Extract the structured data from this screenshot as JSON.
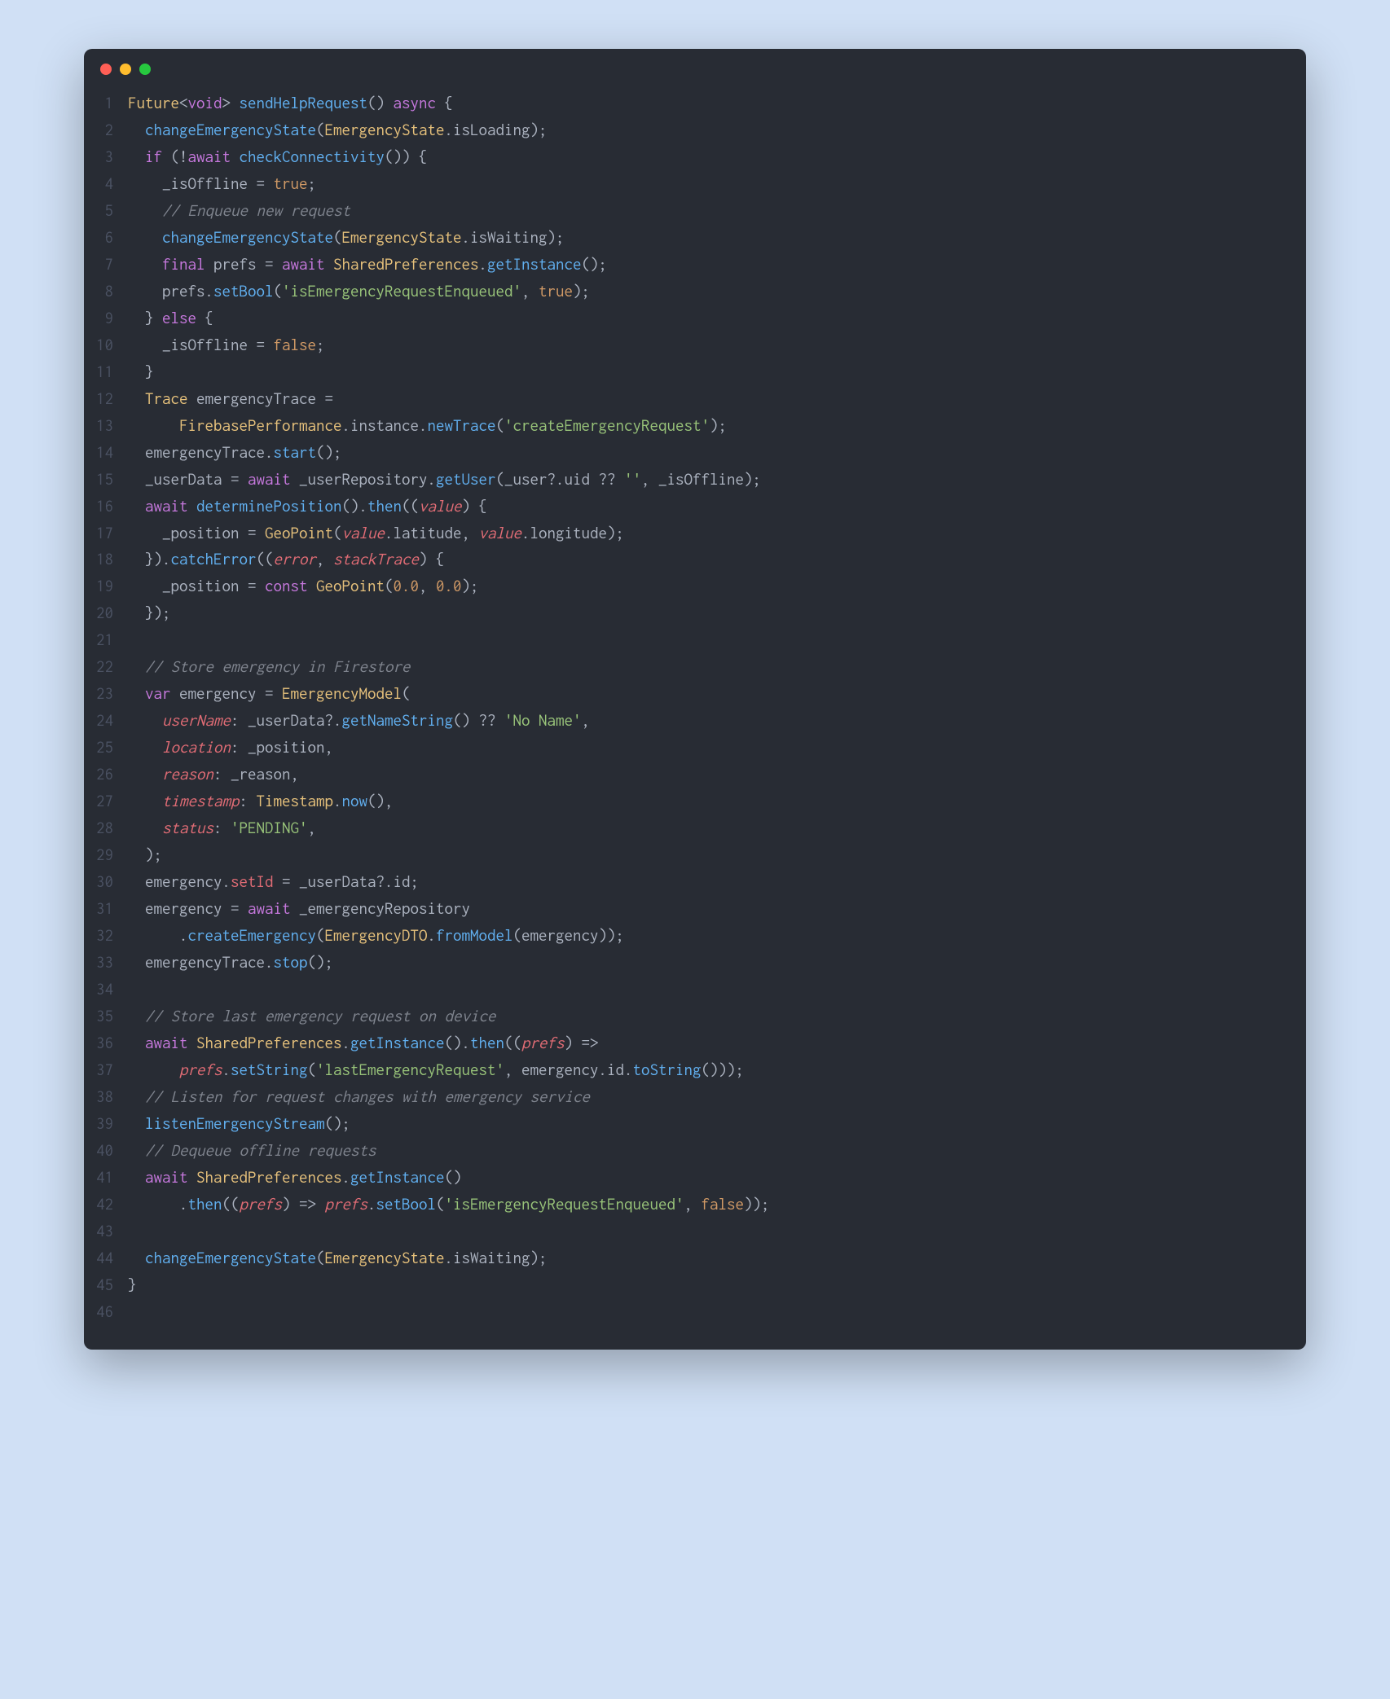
{
  "window": {
    "traffic": {
      "red": "#ff5f56",
      "yellow": "#ffbd2e",
      "green": "#27c93f"
    }
  },
  "code": {
    "lines": [
      {
        "n": 1,
        "t": [
          [
            "type",
            "Future"
          ],
          [
            "punct",
            "<"
          ],
          [
            "kw",
            "void"
          ],
          [
            "punct",
            ">"
          ],
          [
            "ident",
            " "
          ],
          [
            "fn",
            "sendHelpRequest"
          ],
          [
            "punct",
            "() "
          ],
          [
            "kw",
            "async"
          ],
          [
            "punct",
            " {"
          ]
        ]
      },
      {
        "n": 2,
        "t": [
          [
            "ident",
            "  "
          ],
          [
            "fn",
            "changeEmergencyState"
          ],
          [
            "punct",
            "("
          ],
          [
            "type",
            "EmergencyState"
          ],
          [
            "punct",
            "."
          ],
          [
            "ident",
            "isLoading"
          ],
          [
            "punct",
            ");"
          ]
        ]
      },
      {
        "n": 3,
        "t": [
          [
            "ident",
            "  "
          ],
          [
            "kw",
            "if"
          ],
          [
            "punct",
            " (!"
          ],
          [
            "kw",
            "await"
          ],
          [
            "ident",
            " "
          ],
          [
            "fn",
            "checkConnectivity"
          ],
          [
            "punct",
            "()) {"
          ]
        ]
      },
      {
        "n": 4,
        "t": [
          [
            "ident",
            "    _isOffline "
          ],
          [
            "op",
            "="
          ],
          [
            "ident",
            " "
          ],
          [
            "bool",
            "true"
          ],
          [
            "punct",
            ";"
          ]
        ]
      },
      {
        "n": 5,
        "t": [
          [
            "ident",
            "    "
          ],
          [
            "comment",
            "// Enqueue new request"
          ]
        ]
      },
      {
        "n": 6,
        "t": [
          [
            "ident",
            "    "
          ],
          [
            "fn",
            "changeEmergencyState"
          ],
          [
            "punct",
            "("
          ],
          [
            "type",
            "EmergencyState"
          ],
          [
            "punct",
            "."
          ],
          [
            "ident",
            "isWaiting"
          ],
          [
            "punct",
            ");"
          ]
        ]
      },
      {
        "n": 7,
        "t": [
          [
            "ident",
            "    "
          ],
          [
            "kw",
            "final"
          ],
          [
            "ident",
            " prefs "
          ],
          [
            "op",
            "="
          ],
          [
            "ident",
            " "
          ],
          [
            "kw",
            "await"
          ],
          [
            "ident",
            " "
          ],
          [
            "type",
            "SharedPreferences"
          ],
          [
            "punct",
            "."
          ],
          [
            "fn",
            "getInstance"
          ],
          [
            "punct",
            "();"
          ]
        ]
      },
      {
        "n": 8,
        "t": [
          [
            "ident",
            "    prefs."
          ],
          [
            "fn",
            "setBool"
          ],
          [
            "punct",
            "("
          ],
          [
            "str",
            "'isEmergencyRequestEnqueued'"
          ],
          [
            "punct",
            ", "
          ],
          [
            "bool",
            "true"
          ],
          [
            "punct",
            ");"
          ]
        ]
      },
      {
        "n": 9,
        "t": [
          [
            "ident",
            "  } "
          ],
          [
            "kw",
            "else"
          ],
          [
            "punct",
            " {"
          ]
        ]
      },
      {
        "n": 10,
        "t": [
          [
            "ident",
            "    _isOffline "
          ],
          [
            "op",
            "="
          ],
          [
            "ident",
            " "
          ],
          [
            "bool",
            "false"
          ],
          [
            "punct",
            ";"
          ]
        ]
      },
      {
        "n": 11,
        "t": [
          [
            "ident",
            "  }"
          ]
        ]
      },
      {
        "n": 12,
        "t": [
          [
            "ident",
            "  "
          ],
          [
            "type",
            "Trace"
          ],
          [
            "ident",
            " emergencyTrace "
          ],
          [
            "op",
            "="
          ]
        ]
      },
      {
        "n": 13,
        "t": [
          [
            "ident",
            "      "
          ],
          [
            "type",
            "FirebasePerformance"
          ],
          [
            "punct",
            "."
          ],
          [
            "ident",
            "instance"
          ],
          [
            "punct",
            "."
          ],
          [
            "fn",
            "newTrace"
          ],
          [
            "punct",
            "("
          ],
          [
            "str",
            "'createEmergencyRequest'"
          ],
          [
            "punct",
            ");"
          ]
        ]
      },
      {
        "n": 14,
        "t": [
          [
            "ident",
            "  emergencyTrace."
          ],
          [
            "fn",
            "start"
          ],
          [
            "punct",
            "();"
          ]
        ]
      },
      {
        "n": 15,
        "t": [
          [
            "ident",
            "  _userData "
          ],
          [
            "op",
            "="
          ],
          [
            "ident",
            " "
          ],
          [
            "kw",
            "await"
          ],
          [
            "ident",
            " _userRepository."
          ],
          [
            "fn",
            "getUser"
          ],
          [
            "punct",
            "(_user?."
          ],
          [
            "ident",
            "uid"
          ],
          [
            "punct",
            " "
          ],
          [
            "op",
            "??"
          ],
          [
            "punct",
            " "
          ],
          [
            "str",
            "''"
          ],
          [
            "punct",
            ", _isOffline);"
          ]
        ]
      },
      {
        "n": 16,
        "t": [
          [
            "ident",
            "  "
          ],
          [
            "kw",
            "await"
          ],
          [
            "ident",
            " "
          ],
          [
            "fn",
            "determinePosition"
          ],
          [
            "punct",
            "()."
          ],
          [
            "fn",
            "then"
          ],
          [
            "punct",
            "(("
          ],
          [
            "param",
            "value"
          ],
          [
            "punct",
            ") {"
          ]
        ]
      },
      {
        "n": 17,
        "t": [
          [
            "ident",
            "    _position "
          ],
          [
            "op",
            "="
          ],
          [
            "ident",
            " "
          ],
          [
            "type",
            "GeoPoint"
          ],
          [
            "punct",
            "("
          ],
          [
            "param",
            "value"
          ],
          [
            "punct",
            "."
          ],
          [
            "ident",
            "latitude"
          ],
          [
            "punct",
            ", "
          ],
          [
            "param",
            "value"
          ],
          [
            "punct",
            "."
          ],
          [
            "ident",
            "longitude"
          ],
          [
            "punct",
            ");"
          ]
        ]
      },
      {
        "n": 18,
        "t": [
          [
            "ident",
            "  })."
          ],
          [
            "fn",
            "catchError"
          ],
          [
            "punct",
            "(("
          ],
          [
            "param",
            "error"
          ],
          [
            "punct",
            ", "
          ],
          [
            "param",
            "stackTrace"
          ],
          [
            "punct",
            ") {"
          ]
        ]
      },
      {
        "n": 19,
        "t": [
          [
            "ident",
            "    _position "
          ],
          [
            "op",
            "="
          ],
          [
            "ident",
            " "
          ],
          [
            "kw",
            "const"
          ],
          [
            "ident",
            " "
          ],
          [
            "type",
            "GeoPoint"
          ],
          [
            "punct",
            "("
          ],
          [
            "num",
            "0.0"
          ],
          [
            "punct",
            ", "
          ],
          [
            "num",
            "0.0"
          ],
          [
            "punct",
            ");"
          ]
        ]
      },
      {
        "n": 20,
        "t": [
          [
            "ident",
            "  });"
          ]
        ]
      },
      {
        "n": 21,
        "t": [
          [
            "ident",
            ""
          ]
        ]
      },
      {
        "n": 22,
        "t": [
          [
            "ident",
            "  "
          ],
          [
            "comment",
            "// Store emergency in Firestore"
          ]
        ]
      },
      {
        "n": 23,
        "t": [
          [
            "ident",
            "  "
          ],
          [
            "kw",
            "var"
          ],
          [
            "ident",
            " emergency "
          ],
          [
            "op",
            "="
          ],
          [
            "ident",
            " "
          ],
          [
            "type",
            "EmergencyModel"
          ],
          [
            "punct",
            "("
          ]
        ]
      },
      {
        "n": 24,
        "t": [
          [
            "ident",
            "    "
          ],
          [
            "named",
            "userName"
          ],
          [
            "punct",
            ": _userData?."
          ],
          [
            "fn",
            "getNameString"
          ],
          [
            "punct",
            "() "
          ],
          [
            "op",
            "??"
          ],
          [
            "punct",
            " "
          ],
          [
            "str",
            "'No Name'"
          ],
          [
            "punct",
            ","
          ]
        ]
      },
      {
        "n": 25,
        "t": [
          [
            "ident",
            "    "
          ],
          [
            "named",
            "location"
          ],
          [
            "punct",
            ": _position,"
          ]
        ]
      },
      {
        "n": 26,
        "t": [
          [
            "ident",
            "    "
          ],
          [
            "named",
            "reason"
          ],
          [
            "punct",
            ": _reason,"
          ]
        ]
      },
      {
        "n": 27,
        "t": [
          [
            "ident",
            "    "
          ],
          [
            "named",
            "timestamp"
          ],
          [
            "punct",
            ": "
          ],
          [
            "type",
            "Timestamp"
          ],
          [
            "punct",
            "."
          ],
          [
            "fn",
            "now"
          ],
          [
            "punct",
            "(),"
          ]
        ]
      },
      {
        "n": 28,
        "t": [
          [
            "ident",
            "    "
          ],
          [
            "named",
            "status"
          ],
          [
            "punct",
            ": "
          ],
          [
            "str",
            "'PENDING'"
          ],
          [
            "punct",
            ","
          ]
        ]
      },
      {
        "n": 29,
        "t": [
          [
            "ident",
            "  );"
          ]
        ]
      },
      {
        "n": 30,
        "t": [
          [
            "ident",
            "  emergency."
          ],
          [
            "prop",
            "setId"
          ],
          [
            "punct",
            " "
          ],
          [
            "op",
            "="
          ],
          [
            "ident",
            " _userData?."
          ],
          [
            "ident",
            "id"
          ],
          [
            "punct",
            ";"
          ]
        ]
      },
      {
        "n": 31,
        "t": [
          [
            "ident",
            "  emergency "
          ],
          [
            "op",
            "="
          ],
          [
            "ident",
            " "
          ],
          [
            "kw",
            "await"
          ],
          [
            "ident",
            " _emergencyRepository"
          ]
        ]
      },
      {
        "n": 32,
        "t": [
          [
            "ident",
            "      ."
          ],
          [
            "fn",
            "createEmergency"
          ],
          [
            "punct",
            "("
          ],
          [
            "type",
            "EmergencyDTO"
          ],
          [
            "punct",
            "."
          ],
          [
            "fn",
            "fromModel"
          ],
          [
            "punct",
            "(emergency));"
          ]
        ]
      },
      {
        "n": 33,
        "t": [
          [
            "ident",
            "  emergencyTrace."
          ],
          [
            "fn",
            "stop"
          ],
          [
            "punct",
            "();"
          ]
        ]
      },
      {
        "n": 34,
        "t": [
          [
            "ident",
            ""
          ]
        ]
      },
      {
        "n": 35,
        "t": [
          [
            "ident",
            "  "
          ],
          [
            "comment",
            "// Store last emergency request on device"
          ]
        ]
      },
      {
        "n": 36,
        "t": [
          [
            "ident",
            "  "
          ],
          [
            "kw",
            "await"
          ],
          [
            "ident",
            " "
          ],
          [
            "type",
            "SharedPreferences"
          ],
          [
            "punct",
            "."
          ],
          [
            "fn",
            "getInstance"
          ],
          [
            "punct",
            "()."
          ],
          [
            "fn",
            "then"
          ],
          [
            "punct",
            "(("
          ],
          [
            "param",
            "prefs"
          ],
          [
            "punct",
            ") "
          ],
          [
            "op",
            "=>"
          ]
        ]
      },
      {
        "n": 37,
        "t": [
          [
            "ident",
            "      "
          ],
          [
            "param",
            "prefs"
          ],
          [
            "punct",
            "."
          ],
          [
            "fn",
            "setString"
          ],
          [
            "punct",
            "("
          ],
          [
            "str",
            "'lastEmergencyRequest'"
          ],
          [
            "punct",
            ", emergency."
          ],
          [
            "ident",
            "id"
          ],
          [
            "punct",
            "."
          ],
          [
            "fn",
            "toString"
          ],
          [
            "punct",
            "()));"
          ]
        ]
      },
      {
        "n": 38,
        "t": [
          [
            "ident",
            "  "
          ],
          [
            "comment",
            "// Listen for request changes with emergency service"
          ]
        ]
      },
      {
        "n": 39,
        "t": [
          [
            "ident",
            "  "
          ],
          [
            "fn",
            "listenEmergencyStream"
          ],
          [
            "punct",
            "();"
          ]
        ]
      },
      {
        "n": 40,
        "t": [
          [
            "ident",
            "  "
          ],
          [
            "comment",
            "// Dequeue offline requests"
          ]
        ]
      },
      {
        "n": 41,
        "t": [
          [
            "ident",
            "  "
          ],
          [
            "kw",
            "await"
          ],
          [
            "ident",
            " "
          ],
          [
            "type",
            "SharedPreferences"
          ],
          [
            "punct",
            "."
          ],
          [
            "fn",
            "getInstance"
          ],
          [
            "punct",
            "()"
          ]
        ]
      },
      {
        "n": 42,
        "t": [
          [
            "ident",
            "      ."
          ],
          [
            "fn",
            "then"
          ],
          [
            "punct",
            "(("
          ],
          [
            "param",
            "prefs"
          ],
          [
            "punct",
            ") "
          ],
          [
            "op",
            "=>"
          ],
          [
            "punct",
            " "
          ],
          [
            "param",
            "prefs"
          ],
          [
            "punct",
            "."
          ],
          [
            "fn",
            "setBool"
          ],
          [
            "punct",
            "("
          ],
          [
            "str",
            "'isEmergencyRequestEnqueued'"
          ],
          [
            "punct",
            ", "
          ],
          [
            "bool",
            "false"
          ],
          [
            "punct",
            "));"
          ]
        ]
      },
      {
        "n": 43,
        "t": [
          [
            "ident",
            ""
          ]
        ]
      },
      {
        "n": 44,
        "t": [
          [
            "ident",
            "  "
          ],
          [
            "fn",
            "changeEmergencyState"
          ],
          [
            "punct",
            "("
          ],
          [
            "type",
            "EmergencyState"
          ],
          [
            "punct",
            "."
          ],
          [
            "ident",
            "isWaiting"
          ],
          [
            "punct",
            ");"
          ]
        ]
      },
      {
        "n": 45,
        "t": [
          [
            "ident",
            "}"
          ]
        ]
      },
      {
        "n": 46,
        "t": [
          [
            "ident",
            ""
          ]
        ]
      }
    ]
  }
}
